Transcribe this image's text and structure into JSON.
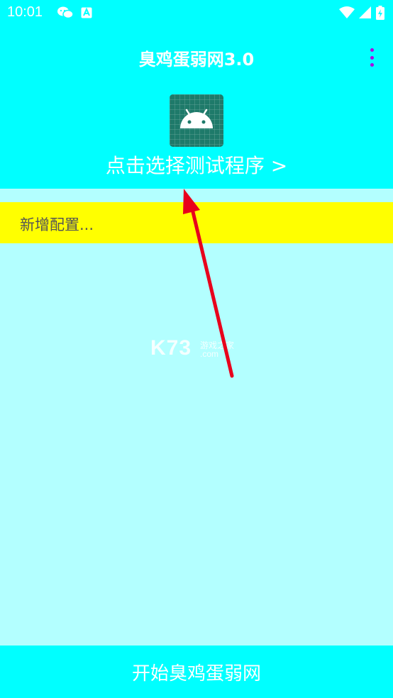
{
  "status_bar": {
    "time": "10:01",
    "left_icons": [
      "wechat-icon",
      "a-badge-icon"
    ],
    "right_icons": [
      "wifi-icon",
      "signal-icon",
      "battery-icon"
    ]
  },
  "app_bar": {
    "title": "臭鸡蛋弱网3.0",
    "menu_icon": "overflow-menu-icon"
  },
  "program_select": {
    "icon": "android-icon",
    "label": "点击选择测试程序 >"
  },
  "config": {
    "label": "新增配置..."
  },
  "watermark": {
    "brand": "K73",
    "tagline": "游戏之家",
    "domain": ".com"
  },
  "bottom": {
    "start_label": "开始臭鸡蛋弱网"
  },
  "colors": {
    "header_bg": "#00ffff",
    "body_bg": "#b3ffff",
    "config_bg": "#ffff00",
    "menu_dots": "#b000e0",
    "arrow": "#e8001c"
  }
}
